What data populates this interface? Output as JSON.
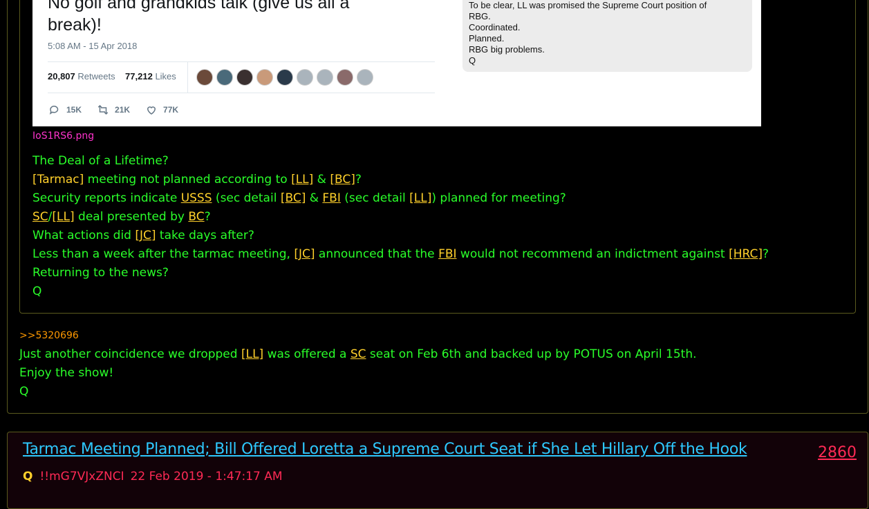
{
  "tweet": {
    "text_tail": "No golf and grandkids talk (give us all a",
    "text_tail2": "break)!",
    "date": "5:08 AM - 15 Apr 2018",
    "retweets_count": "20,807",
    "retweets_label": "Retweets",
    "likes_count": "77,212",
    "likes_label": "Likes",
    "reply_count": "15K",
    "retweet_action_count": "21K",
    "like_action_count": "77K"
  },
  "image_text": {
    "line1": "To be clear, LL was promised the Supreme Court position of",
    "line2": "RBG.",
    "line3": "Coordinated.",
    "line4": "Planned.",
    "line5": "RBG big problems.",
    "line6": "Q"
  },
  "inner_post": {
    "filename": "IoS1RS6.png",
    "l1": "The Deal of a Lifetime?",
    "l2_tag1": "[Tarmac]",
    "l2_a": " meeting not planned according to ",
    "l2_tag2": "[LL]",
    "l2_b": " & ",
    "l2_tag3": "[BC]",
    "l2_c": "?",
    "l3_a": "Security reports indicate ",
    "l3_tag1": "USSS",
    "l3_b": " (sec detail ",
    "l3_tag2": "[BC]",
    "l3_c": " & ",
    "l3_tag3": "FBI",
    "l3_d": " (sec detail ",
    "l3_tag4": "[LL]",
    "l3_e": ") planned for meeting?",
    "l4_tag1": "SC",
    "l4_a": "/",
    "l4_tag2": "[LL]",
    "l4_b": " deal presented by ",
    "l4_tag3": "BC",
    "l4_c": "?",
    "l5_a": "What actions did ",
    "l5_tag": "[JC]",
    "l5_b": " take days after?",
    "l6_a": "Less than a week after the tarmac meeting, ",
    "l6_tag1": "[JC]",
    "l6_b": " announced that the ",
    "l6_tag2": "FBI",
    "l6_c": " would not recommend an indictment against ",
    "l6_tag3": "[HRC]",
    "l6_d": "?",
    "l7": "Returning to the news?",
    "l8": "Q"
  },
  "outer_post": {
    "ref": ">>5320696",
    "l1_a": "Just another coincidence we dropped ",
    "l1_tag1": "[LL]",
    "l1_b": " was offered a ",
    "l1_tag2": "SC",
    "l1_c": " seat on Feb 6th and backed up by POTUS on April 15th.",
    "l2": "Enjoy the show!",
    "l3": "Q"
  },
  "next_post": {
    "title": "Tarmac Meeting Planned; Bill Offered Loretta a Supreme Court Seat if She Let Hillary Off the Hook",
    "number": "2860",
    "author": "Q",
    "tripcode": "!!mG7VJxZNCI",
    "datetime": "22 Feb 2019 - 1:47:17 AM"
  },
  "colors": {
    "green_text": "#2aff2a",
    "tag_yellow": "#ffd02b",
    "filename_pink": "#ff33cc",
    "ref_orange": "#ff9900",
    "title_blue": "#2ec9ff",
    "accent_red": "#ff2a55"
  }
}
